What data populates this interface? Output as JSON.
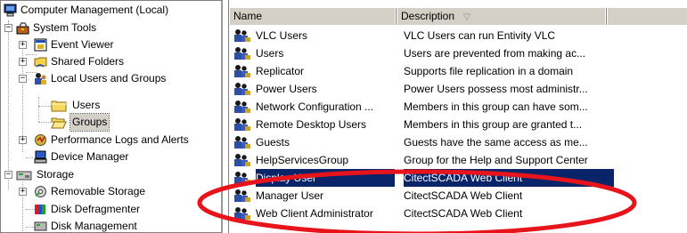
{
  "tree": {
    "items": [
      {
        "label": "Computer Management (Local)",
        "icon": "computer-icon",
        "expander": ""
      },
      {
        "label": "System Tools",
        "icon": "toolbox-icon",
        "expander": "−"
      },
      {
        "label": "Event Viewer",
        "icon": "event-viewer-icon",
        "expander": "+"
      },
      {
        "label": "Shared Folders",
        "icon": "shared-folder-icon",
        "expander": "+"
      },
      {
        "label": "Local Users and Groups",
        "icon": "users-groups-icon",
        "expander": "−"
      },
      {
        "label": "Users",
        "icon": "folder-icon",
        "expander": ""
      },
      {
        "label": "Groups",
        "icon": "folder-open-icon",
        "expander": "",
        "selected": true
      },
      {
        "label": "Performance Logs and Alerts",
        "icon": "performance-icon",
        "expander": "+"
      },
      {
        "label": "Device Manager",
        "icon": "device-manager-icon",
        "expander": ""
      },
      {
        "label": "Storage",
        "icon": "storage-icon",
        "expander": "−"
      },
      {
        "label": "Removable Storage",
        "icon": "removable-storage-icon",
        "expander": "+"
      },
      {
        "label": "Disk Defragmenter",
        "icon": "defrag-icon",
        "expander": ""
      },
      {
        "label": "Disk Management",
        "icon": "disk-management-icon",
        "expander": ""
      }
    ]
  },
  "list": {
    "columns": {
      "name": "Name",
      "description": "Description"
    },
    "rows": [
      {
        "name": "VLC Users",
        "description": "VLC Users can run Entivity VLC"
      },
      {
        "name": "Users",
        "description": "Users are prevented from making ac..."
      },
      {
        "name": "Replicator",
        "description": "Supports file replication in a domain"
      },
      {
        "name": "Power Users",
        "description": "Power Users possess most administr..."
      },
      {
        "name": "Network Configuration ...",
        "description": "Members in this group can have som..."
      },
      {
        "name": "Remote Desktop Users",
        "description": "Members in this group are granted t..."
      },
      {
        "name": "Guests",
        "description": "Guests have the same access as me..."
      },
      {
        "name": "HelpServicesGroup",
        "description": "Group for the Help and Support Center"
      },
      {
        "name": "Display User",
        "description": "CitectSCADA Web Client",
        "selected": true
      },
      {
        "name": "Manager User",
        "description": "CitectSCADA Web Client"
      },
      {
        "name": "Web Client Administrator",
        "description": "CitectSCADA Web Client"
      }
    ]
  },
  "annotation": {
    "shape": "ellipse",
    "color": "#e8141b"
  },
  "colors": {
    "selection": "#0a246a",
    "chrome": "#d4d0c8"
  }
}
